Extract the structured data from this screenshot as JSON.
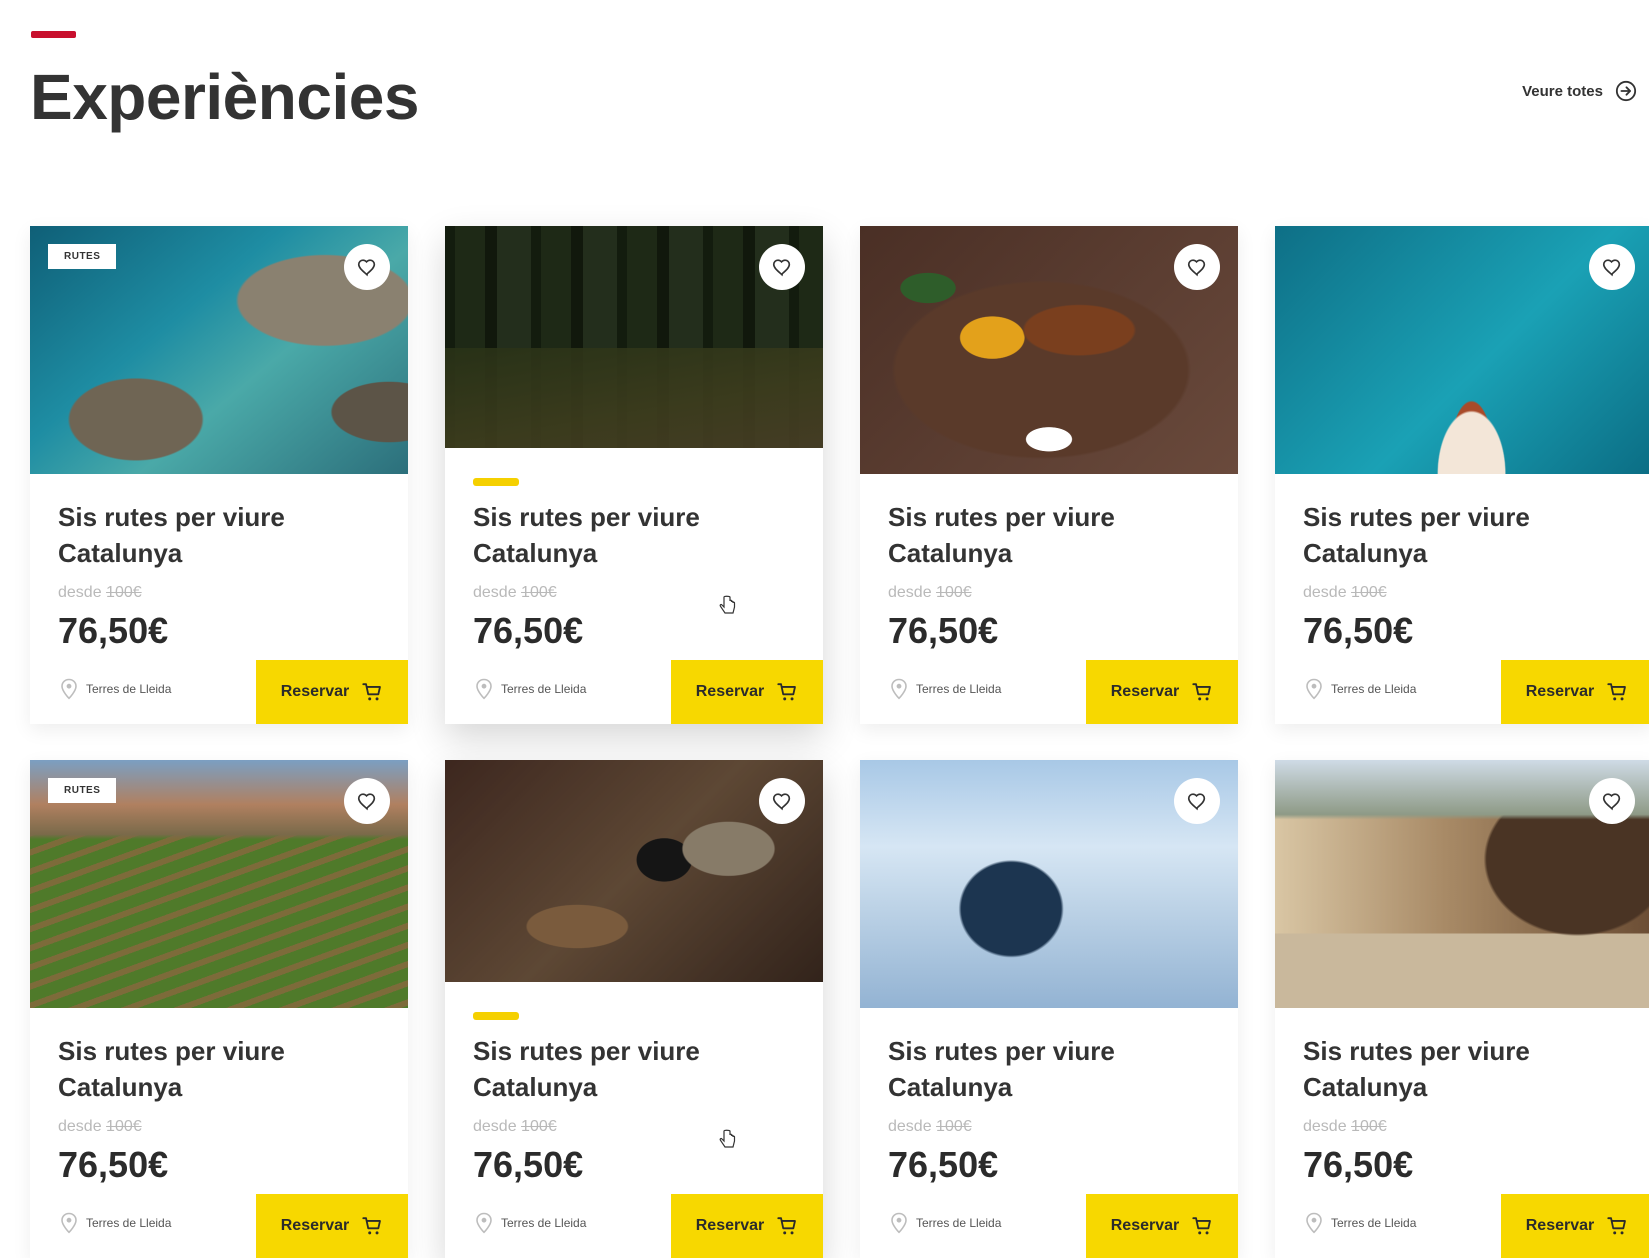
{
  "header": {
    "title": "Experiències",
    "see_all_label": "Veure totes",
    "accent_color": "#c8102e"
  },
  "theme": {
    "button_color": "#f7d800",
    "text_color": "#2b2b2b"
  },
  "cards": [
    {
      "tag": "RUTES",
      "title": "Sis rutes per viure Catalunya",
      "from_label": "desde",
      "old_price": "100€",
      "price": "76,50€",
      "location": "Terres de Lleida",
      "button_label": "Reservar",
      "image": "coastal-cove"
    },
    {
      "tag": "",
      "title": "Sis rutes per viure Catalunya",
      "from_label": "desde",
      "old_price": "100€",
      "price": "76,50€",
      "location": "Terres de Lleida",
      "button_label": "Reservar",
      "image": "forest",
      "hovered": true
    },
    {
      "tag": "",
      "title": "Sis rutes per viure Catalunya",
      "from_label": "desde",
      "old_price": "100€",
      "price": "76,50€",
      "location": "Terres de Lleida",
      "button_label": "Reservar",
      "image": "food-dish"
    },
    {
      "tag": "",
      "title": "Sis rutes per viure Catalunya",
      "from_label": "desde",
      "old_price": "100€",
      "price": "76,50€",
      "location": "Terres de Lleida",
      "button_label": "Reservar",
      "image": "boat-at-sea"
    },
    {
      "tag": "RUTES",
      "title": "Sis rutes per viure Catalunya",
      "from_label": "desde",
      "old_price": "100€",
      "price": "76,50€",
      "location": "Terres de Lleida",
      "button_label": "Reservar",
      "image": "vineyard-hikers"
    },
    {
      "tag": "",
      "title": "Sis rutes per viure Catalunya",
      "from_label": "desde",
      "old_price": "100€",
      "price": "76,50€",
      "location": "Terres de Lleida",
      "button_label": "Reservar",
      "image": "cheese-market",
      "hovered": true
    },
    {
      "tag": "",
      "title": "Sis rutes per viure Catalunya",
      "from_label": "desde",
      "old_price": "100€",
      "price": "76,50€",
      "location": "Terres de Lleida",
      "button_label": "Reservar",
      "image": "snowy-tree"
    },
    {
      "tag": "",
      "title": "Sis rutes per viure Catalunya",
      "from_label": "desde",
      "old_price": "100€",
      "price": "76,50€",
      "location": "Terres de Lleida",
      "button_label": "Reservar",
      "image": "mountain-village"
    }
  ],
  "icons": {
    "favorite": "heart-icon",
    "location": "map-pin-icon",
    "cart": "cart-icon",
    "see_all": "arrow-right-circle-icon"
  }
}
